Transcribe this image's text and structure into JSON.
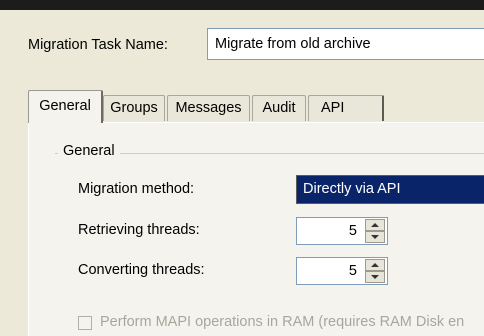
{
  "task": {
    "label": "Migration Task Name:",
    "value": "Migrate from old archive"
  },
  "tabs": [
    {
      "label": "General",
      "active": true
    },
    {
      "label": "Groups",
      "active": false
    },
    {
      "label": "Messages",
      "active": false
    },
    {
      "label": "Audit",
      "active": false
    },
    {
      "label": "API",
      "active": false
    }
  ],
  "general": {
    "group_title": "General",
    "method_label": "Migration method:",
    "method_value": "Directly via  API",
    "retrieving_label": "Retrieving threads:",
    "retrieving_value": "5",
    "converting_label": "Converting threads:",
    "converting_value": "5",
    "ram_label": "Perform MAPI operations in RAM (requires RAM Disk en",
    "ram_checked": false
  },
  "colors": {
    "selection": "#0a246a",
    "dialog_bg": "#ece9d8",
    "panel_bg": "#f4f3ee",
    "disabled_text": "#a8a79c"
  }
}
